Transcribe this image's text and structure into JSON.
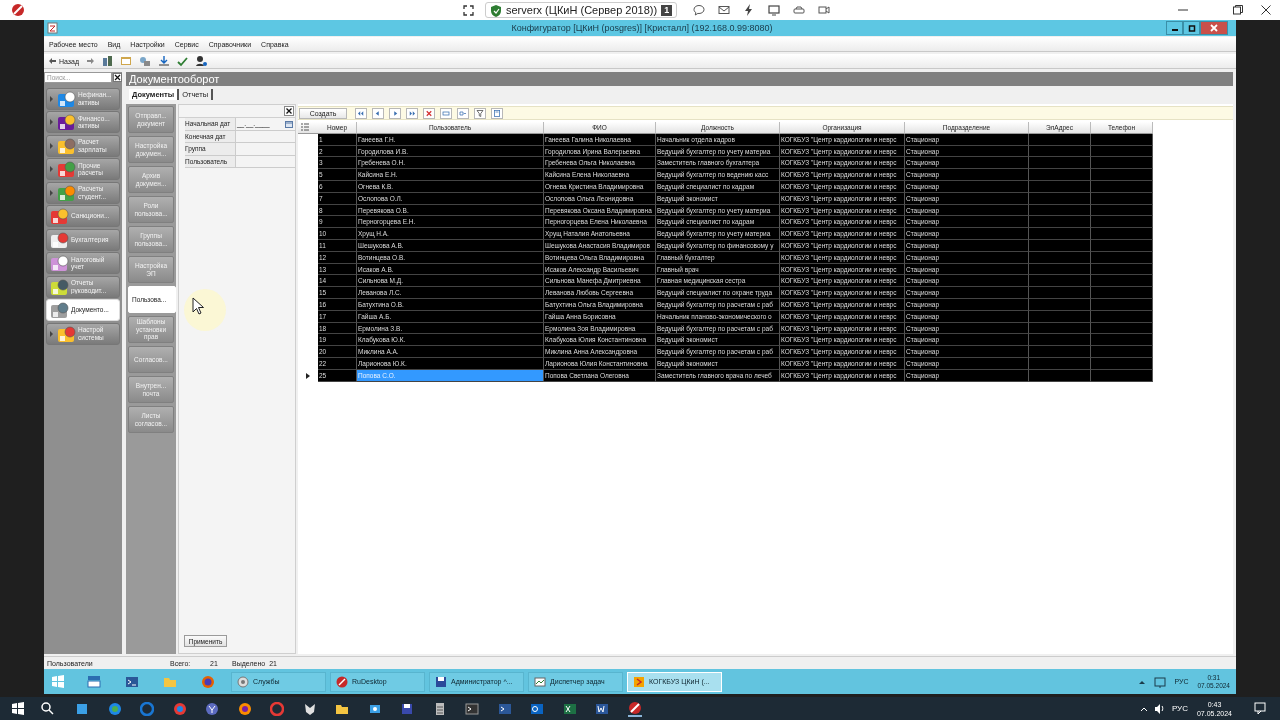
{
  "viewer": {
    "session": "serverx (ЦКиН (Сервер 2018))",
    "session_badge": "1"
  },
  "window": {
    "title": "Конфигуратор [ЦКиН (posgres)] [Кристалл] (192.168.0.99:8080)"
  },
  "menu": [
    "Рабочее место",
    "Вид",
    "Настройки",
    "Сервис",
    "Справочники",
    "Справка"
  ],
  "toolbar": {
    "back": "Назад"
  },
  "sidebar": {
    "search_placeholder": "Поиск...",
    "items": [
      {
        "label": "Нефинан... активы",
        "expandable": true,
        "selected": false
      },
      {
        "label": "Финансо... активы",
        "expandable": true,
        "selected": false
      },
      {
        "label": "Расчет зарплаты",
        "expandable": true,
        "selected": false
      },
      {
        "label": "Прочие расчеты",
        "expandable": true,
        "selected": false
      },
      {
        "label": "Расчеты студент...",
        "expandable": true,
        "selected": false
      },
      {
        "label": "Санкциони...",
        "expandable": false,
        "selected": false
      },
      {
        "label": "Бухгалтерия",
        "expandable": false,
        "selected": false
      },
      {
        "label": "Налоговый учет",
        "expandable": false,
        "selected": false
      },
      {
        "label": "Отчеты руководит...",
        "expandable": false,
        "selected": false
      },
      {
        "label": "Документо...",
        "expandable": false,
        "selected": true
      },
      {
        "label": "Настрой системы",
        "expandable": true,
        "selected": false
      }
    ]
  },
  "module": {
    "title": "Документооборот",
    "tabs": [
      {
        "label": "Документы",
        "selected": true
      },
      {
        "label": "Отчеты",
        "selected": false
      }
    ],
    "nav": [
      {
        "label": "Отправл... документ",
        "selected": false
      },
      {
        "label": "Настройка докумен...",
        "selected": false
      },
      {
        "label": "Архив докумен...",
        "selected": false
      },
      {
        "label": "Роли пользова...",
        "selected": false
      },
      {
        "label": "Группы пользова...",
        "selected": false
      },
      {
        "label": "Настройка ЭП",
        "selected": false
      },
      {
        "label": "Пользова...",
        "selected": true
      },
      {
        "label": "Шаблоны установки прав",
        "selected": false
      },
      {
        "label": "Согласов...",
        "selected": false
      },
      {
        "label": "Внутрен... почта",
        "selected": false
      },
      {
        "label": "Листы согласов...",
        "selected": false
      }
    ],
    "filter": {
      "fields": [
        {
          "label": "Начальная дат",
          "kind": "date",
          "value": "__.__.____"
        },
        {
          "label": "Конечная дат",
          "kind": "text"
        },
        {
          "label": "Группа",
          "kind": "text"
        },
        {
          "label": "Пользователь",
          "kind": "text"
        }
      ],
      "apply": "Применить"
    }
  },
  "grid": {
    "create": "Создать",
    "columns": [
      "Номер",
      "Пользователь",
      "ФИО",
      "Должность",
      "Организация",
      "Подразделение",
      "ЭлАдрес",
      "Телефон"
    ],
    "rows": [
      {
        "selected": false,
        "cells": [
          "1",
          "Ганеева Г.Н.",
          "Ганеева Галина Николаевна",
          "Начальник отдела кадров",
          "КОГКБУЗ \"Центр кардиологии и неврс",
          "Стационар"
        ]
      },
      {
        "selected": false,
        "cells": [
          "2",
          "Городилова И.В.",
          "Городилова Ирина Валерьевна",
          "Ведущий бухгалтер по учету материа",
          "КОГКБУЗ \"Центр кардиологии и неврс",
          "Стационар"
        ]
      },
      {
        "selected": false,
        "cells": [
          "3",
          "Гребенева О.Н.",
          "Гребенева Ольга Николаевна",
          "Заместитель главного бухгалтера",
          "КОГКБУЗ \"Центр кардиологии и неврс",
          "Стационар"
        ]
      },
      {
        "selected": false,
        "cells": [
          "5",
          "Кайсина Е.Н.",
          "Кайсина Елена Николаевна",
          "Ведущий бухгалтер по ведению касс",
          "КОГКБУЗ \"Центр кардиологии и неврс",
          "Стационар"
        ]
      },
      {
        "selected": false,
        "cells": [
          "6",
          "Огнева К.В.",
          "Огнева Кристина Владимировна",
          "Ведущий специалист по кадрам",
          "КОГКБУЗ \"Центр кардиологии и неврс",
          "Стационар"
        ]
      },
      {
        "selected": false,
        "cells": [
          "7",
          "Ослопова О.Л.",
          "Ослопова Ольга Леонидовна",
          "Ведущий экономист",
          "КОГКБУЗ \"Центр кардиологии и неврс",
          "Стационар"
        ]
      },
      {
        "selected": false,
        "cells": [
          "8",
          "Перевякова О.В.",
          "Перевякова Оксана Владимировна",
          "Ведущий бухгалтер по учету материа",
          "КОГКБУЗ \"Центр кардиологии и неврс",
          "Стационар"
        ]
      },
      {
        "selected": false,
        "cells": [
          "9",
          "Перногорцева Е.Н.",
          "Перногорцева Елена Николаевна",
          "Ведущий специалист по кадрам",
          "КОГКБУЗ \"Центр кардиологии и неврс",
          "Стационар"
        ]
      },
      {
        "selected": false,
        "cells": [
          "10",
          "Хрущ Н.А.",
          "Хрущ Наталия Анатольевна",
          "Ведущий бухгалтер по учету материа",
          "КОГКБУЗ \"Центр кардиологии и неврс",
          "Стационар"
        ]
      },
      {
        "selected": false,
        "cells": [
          "11",
          "Шешукова А.В.",
          "Шешукова Анастасия Владимиров",
          "Ведущий бухгалтер по финансовому у",
          "КОГКБУЗ \"Центр кардиологии и неврс",
          "Стационар"
        ]
      },
      {
        "selected": false,
        "cells": [
          "12",
          "Вотинцева О.В.",
          "Вотинцева Ольга Владимировна",
          "Главный бухгалтер",
          "КОГКБУЗ \"Центр кардиологии и неврс",
          "Стационар"
        ]
      },
      {
        "selected": false,
        "cells": [
          "13",
          "Исаков А.В.",
          "Исаков Александр Васильевич",
          "Главный врач",
          "КОГКБУЗ \"Центр кардиологии и неврс",
          "Стационар"
        ]
      },
      {
        "selected": false,
        "cells": [
          "14",
          "Сильнова М.Д.",
          "Сильнова Манефа Дмитриевна",
          "Главная медицинская сестра",
          "КОГКБУЗ \"Центр кардиологии и неврс",
          "Стационар"
        ]
      },
      {
        "selected": false,
        "cells": [
          "15",
          "Леванова Л.С.",
          "Леванова Любовь Сергеевна",
          "Ведущий специалист по охране труда",
          "КОГКБУЗ \"Центр кардиологии и неврс",
          "Стационар"
        ]
      },
      {
        "selected": false,
        "cells": [
          "16",
          "Батухтина О.В.",
          "Батухтина Ольга Владимировна",
          "Ведущий бухгалтер по расчетам с раб",
          "КОГКБУЗ \"Центр кардиологии и неврс",
          "Стационар"
        ]
      },
      {
        "selected": false,
        "cells": [
          "17",
          "Гайша А.Б.",
          "Гайша Анна Борисовна",
          "Начальник планово-экономического о",
          "КОГКБУЗ \"Центр кардиологии и неврс",
          "Стационар"
        ]
      },
      {
        "selected": false,
        "cells": [
          "18",
          "Ермолина З.В.",
          "Ермолина Зоя Владимировна",
          "Ведущий бухгалтер по расчетам с раб",
          "КОГКБУЗ \"Центр кардиологии и неврс",
          "Стационар"
        ]
      },
      {
        "selected": false,
        "cells": [
          "19",
          "Клабукова Ю.К.",
          "Клабукова Юлия Константиновна",
          "Ведущий экономист",
          "КОГКБУЗ \"Центр кардиологии и неврс",
          "Стационар"
        ]
      },
      {
        "selected": false,
        "cells": [
          "20",
          "Миклина А.А.",
          "Миклина Анна Александровна",
          "Ведущий бухгалтер по расчетам с раб",
          "КОГКБУЗ \"Центр кардиологии и неврс",
          "Стационар"
        ]
      },
      {
        "selected": false,
        "cells": [
          "22",
          "Ларионова Ю.К.",
          "Ларионова Юлия Константиновна",
          "Ведущий экономист",
          "КОГКБУЗ \"Центр кардиологии и неврс",
          "Стационар"
        ]
      },
      {
        "selected": true,
        "cells": [
          "25",
          "Попова С.О.",
          "Попова Светлана Олеговна",
          "Заместитель главного врача по лечеб",
          "КОГКБУЗ \"Центр кардиологии и неврс",
          "Стационар"
        ]
      }
    ]
  },
  "status_bar": {
    "label": "Пользователи",
    "total_label": "Всего:",
    "total": "21",
    "selected_label": "Выделено",
    "selected_count": "21"
  },
  "remote_taskbar": {
    "items": [
      {
        "label": "Службы",
        "active": false
      },
      {
        "label": "RuDesktop",
        "active": false
      },
      {
        "label": "Администратор ^...",
        "active": false
      },
      {
        "label": "Диспетчер задач",
        "active": false
      },
      {
        "label": "КОГКБУЗ ЦКиН (...",
        "active": true
      }
    ],
    "lang": "РУС",
    "time": "0:31",
    "date": "07.05.2024"
  },
  "local_taskbar": {
    "lang": "РУС",
    "time": "0:43",
    "date": "07.05.2024"
  }
}
